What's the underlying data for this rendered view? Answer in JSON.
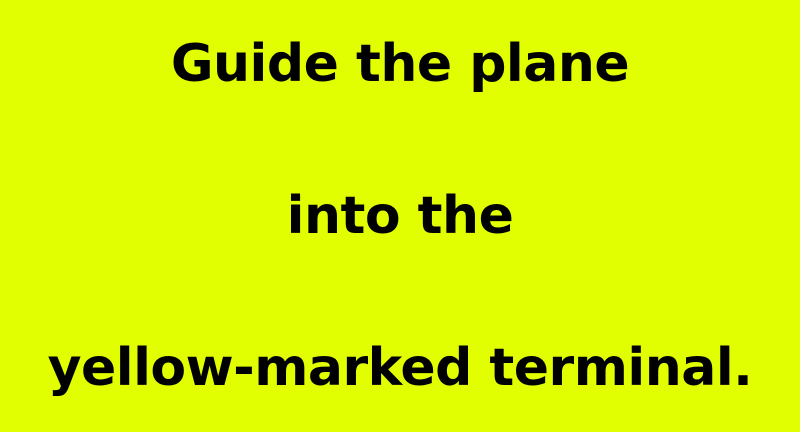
{
  "instruction": {
    "line_1": "Guide the plane",
    "line_2": "into the",
    "line_3": "yellow-marked terminal."
  },
  "colors": {
    "background": "#e1ff00",
    "text": "#000000"
  }
}
